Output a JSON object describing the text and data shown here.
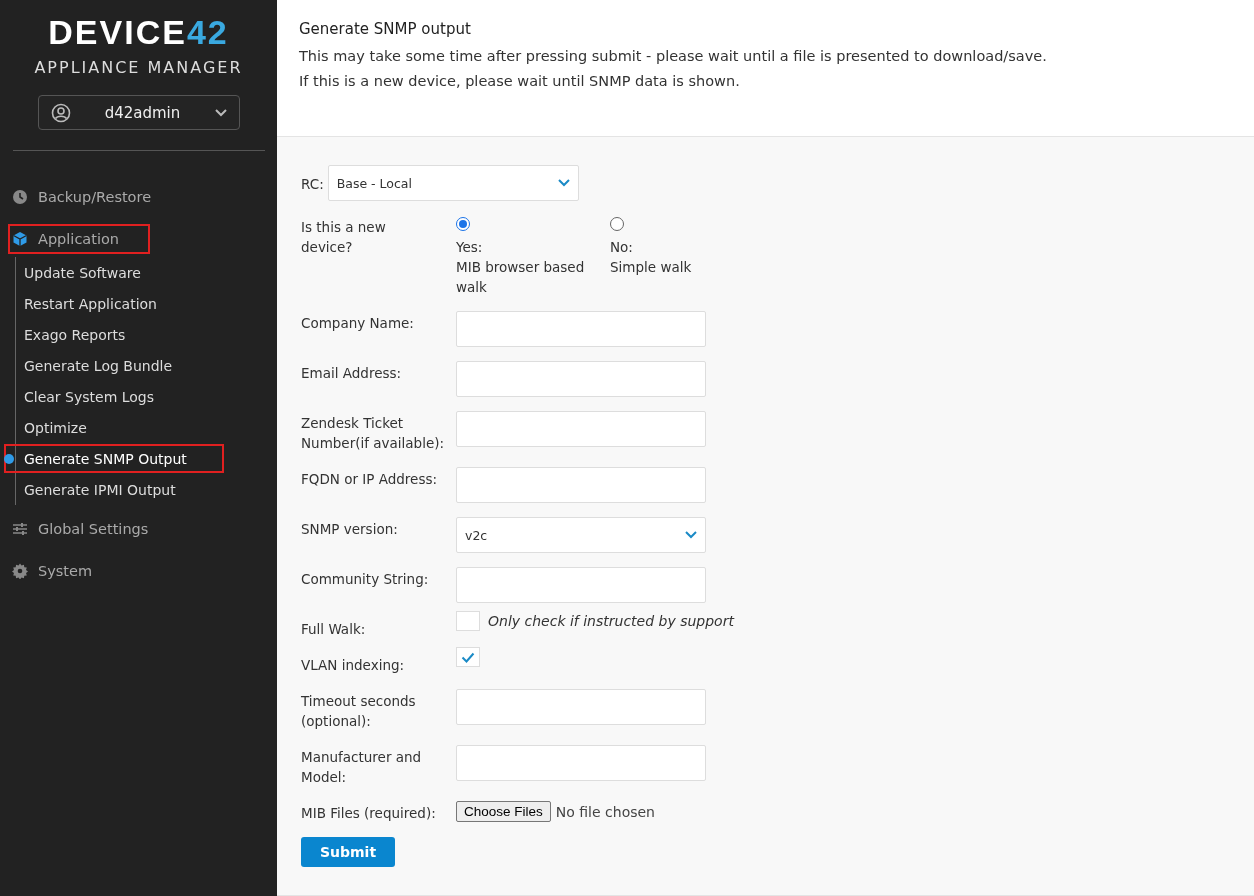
{
  "sidebar": {
    "logo": {
      "word": "DEVICE",
      "number": "42"
    },
    "subtitle": "APPLIANCE MANAGER",
    "user": {
      "name": "d42admin"
    },
    "nav": [
      {
        "label": "Backup/Restore",
        "kind": "clock",
        "highlighted": false
      },
      {
        "label": "Application",
        "kind": "cube",
        "highlighted": true,
        "children": [
          {
            "label": "Update Software",
            "selected": false,
            "highlighted": false
          },
          {
            "label": "Restart Application",
            "selected": false,
            "highlighted": false
          },
          {
            "label": "Exago Reports",
            "selected": false,
            "highlighted": false
          },
          {
            "label": "Generate Log Bundle",
            "selected": false,
            "highlighted": false
          },
          {
            "label": "Clear System Logs",
            "selected": false,
            "highlighted": false
          },
          {
            "label": "Optimize",
            "selected": false,
            "highlighted": false
          },
          {
            "label": "Generate SNMP Output",
            "selected": true,
            "highlighted": true
          },
          {
            "label": "Generate IPMI Output",
            "selected": false,
            "highlighted": false
          }
        ]
      },
      {
        "label": "Global Settings",
        "kind": "sliders",
        "highlighted": false
      },
      {
        "label": "System",
        "kind": "gear",
        "highlighted": false
      }
    ]
  },
  "header": {
    "title": "Generate SNMP output",
    "lines": [
      "This may take some time after pressing submit - please wait until a file is presented to download/save.",
      "If this is a new device, please wait until SNMP data is shown."
    ]
  },
  "form": {
    "rc": {
      "label": "RC:",
      "value": "Base - Local"
    },
    "new_device": {
      "label": "Is this a new device?",
      "options": [
        {
          "title": "Yes:",
          "subtitle": "MIB browser based walk",
          "selected": true
        },
        {
          "title": "No:",
          "subtitle": "Simple walk",
          "selected": false
        }
      ]
    },
    "fields": [
      {
        "kind": "text",
        "label": "Company Name:"
      },
      {
        "kind": "text",
        "label": "Email Address:"
      },
      {
        "kind": "text",
        "label": "Zendesk Ticket Number(if available):"
      },
      {
        "kind": "text",
        "label": "FQDN or IP Address:"
      },
      {
        "kind": "select",
        "label": "SNMP version:",
        "value": "v2c"
      },
      {
        "kind": "text",
        "label": "Community String:"
      },
      {
        "kind": "checkbox",
        "label": "Full Walk:",
        "checked": false,
        "note": "Only check if instructed by support"
      },
      {
        "kind": "checkbox",
        "label": "VLAN indexing:",
        "checked": true
      },
      {
        "kind": "text",
        "label": "Timeout seconds (optional):"
      },
      {
        "kind": "text",
        "label": "Manufacturer and Model:"
      },
      {
        "kind": "file",
        "label": "MIB Files (required):",
        "button": "Choose Files",
        "status": "No file chosen"
      }
    ],
    "submit": "Submit"
  }
}
